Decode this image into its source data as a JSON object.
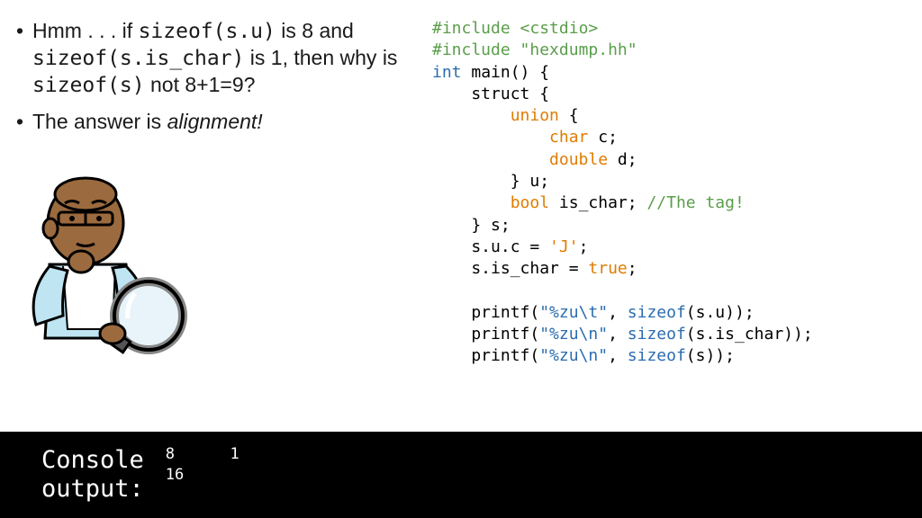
{
  "bullets": [
    {
      "p1": "Hmm . . . if ",
      "c1": "sizeof(s.u)",
      "p2": " is 8 and ",
      "c2": "sizeof(s.is_char)",
      "p3": " is 1, then why is ",
      "c3": "sizeof(s)",
      "p4": " not 8+1=9?"
    },
    {
      "p1": "The answer is ",
      "em": "alignment!"
    }
  ],
  "code": {
    "inc1a": "#include ",
    "inc1b": "<cstdio>",
    "inc2a": "#include ",
    "inc2b": "\"hexdump.hh\"",
    "int": "int",
    "main": " main() {",
    "struct": "    struct {",
    "union": "union",
    "unionbrace": " {",
    "char": "char",
    "cvar": " c;",
    "double": "double",
    "dvar": " d;",
    "closeu": "        } u;",
    "bool": "bool",
    "ischar": " is_char; ",
    "comment": "//The tag!",
    "closes": "    } s;",
    "assign1a": "    s.u.c = ",
    "assign1b": "'J'",
    "assign1c": ";",
    "assign2a": "    s.is_char = ",
    "true": "true",
    "assign2c": ";",
    "printf": "    printf(",
    "str1": "\"%zu\\t\"",
    "mid": ", ",
    "sizeof": "sizeof",
    "arg1": "(s.u));",
    "str2": "\"%zu\\n\"",
    "arg2": "(s.is_char));",
    "str3": "\"%zu\\n\"",
    "arg3": "(s));"
  },
  "console": {
    "label": "Console\noutput:",
    "out": "8      1\n16"
  }
}
